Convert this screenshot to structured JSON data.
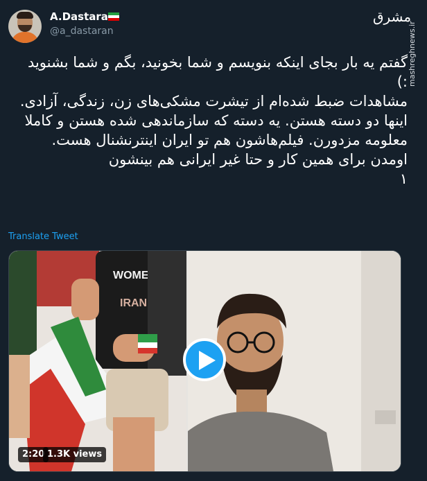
{
  "author": {
    "name": "A.Dastaran",
    "handle": "@a_dastaran",
    "flag_icon": "iran-flag-icon"
  },
  "branding": {
    "logo_text": "مشرق",
    "watermark": "mashreghnews.ir"
  },
  "tweet": {
    "paragraphs": [
      "گفتم یه بار بجای اینکه بنویسم و شما بخونید، بگم و شما بشنوید :)",
      "مشاهدات ضبط شده‌ام از تیشرت مشکی‌های زن، زندگی، آزادی.",
      "اینها دو دسته هستن. یه دسته که سازماندهی شده هستن و کاملا معلومه مزدورن. فیلم‌هاشون هم تو ایران اینترنشنال هست.",
      "اومدن برای همین کار و حتا غیر ایرانی هم بینشون",
      "۱"
    ],
    "translate_label": "Translate Tweet"
  },
  "media": {
    "duration": "2:20",
    "views": "1.3K views",
    "play_icon": "play-icon",
    "shirt_text": "WOMEN IRAN"
  },
  "colors": {
    "background": "#15202b",
    "accent": "#1da1f2",
    "secondary_text": "#8899a6"
  }
}
